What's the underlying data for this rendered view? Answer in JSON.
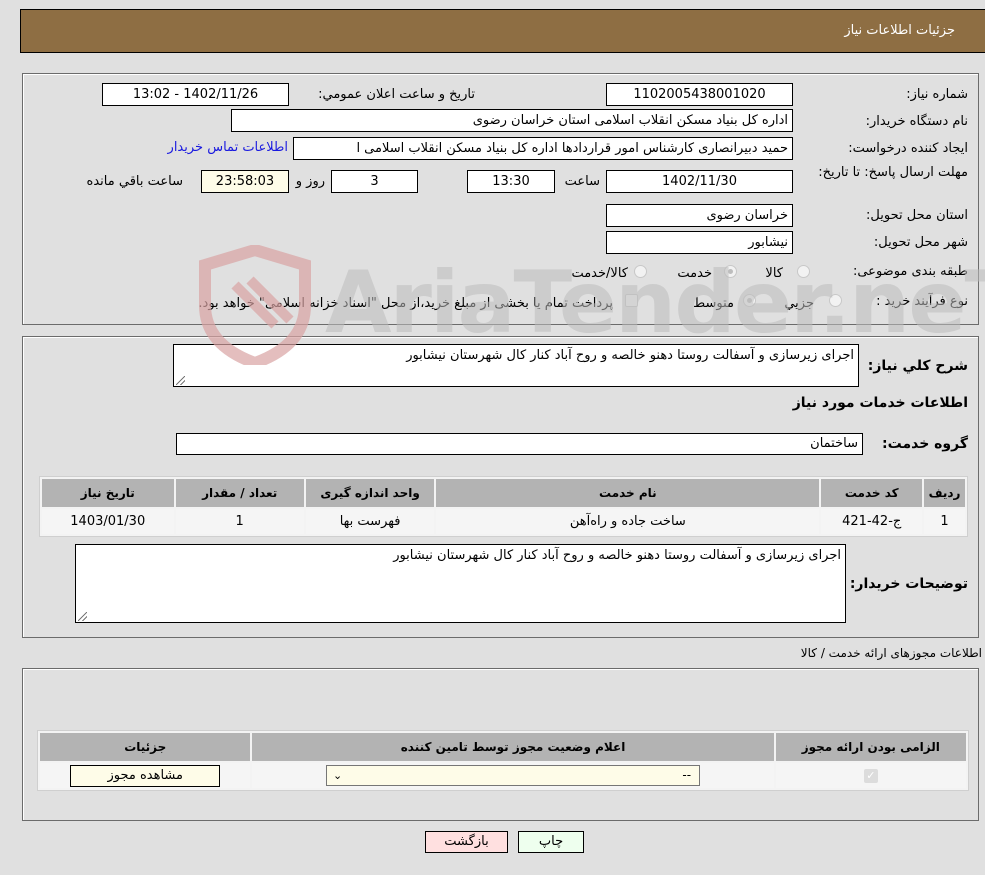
{
  "header": {
    "title": "جزئیات اطلاعات نیاز"
  },
  "details": {
    "need_number_label": "شماره نیاز:",
    "need_number": "1102005438001020",
    "announce_label": "تاریخ و ساعت اعلان عمومي:",
    "announce_value": "1402/11/26 - 13:02",
    "buyer_org_label": "نام دستگاه خریدار:",
    "buyer_org": "اداره کل بنیاد مسکن انقلاب اسلامی استان خراسان رضوی",
    "creator_label": "ایجاد کننده درخواست:",
    "creator": "حمید دبیرانصاری کارشناس امور قراردادها اداره کل بنیاد مسکن انقلاب اسلامی ا",
    "contact_link": "اطلاعات تماس خریدار",
    "deadline_label": "مهلت ارسال پاسخ: تا تاریخ:",
    "deadline_date": "1402/11/30",
    "time_label": "ساعت",
    "deadline_time": "13:30",
    "days_value": "3",
    "days_label": "روز و",
    "remaining_time": "23:58:03",
    "remaining_label": "ساعت باقي مانده",
    "province_label": "استان محل تحویل:",
    "province": "خراسان رضوی",
    "city_label": "شهر محل تحویل:",
    "city": "نیشابور",
    "category_label": "طبقه بندی موضوعی:",
    "category_options": [
      {
        "label": "کالا",
        "checked": false
      },
      {
        "label": "خدمت",
        "checked": true
      },
      {
        "label": "کالا/خدمت",
        "checked": false
      }
    ],
    "process_label": "نوع فرآیند خرید :",
    "process_options": [
      {
        "label": "جزيي",
        "checked": false
      },
      {
        "label": "متوسط",
        "checked": true
      }
    ],
    "treasury_note": "پرداخت تمام یا بخشی از مبلغ خرید،از محل \"اسناد خزانه اسلامی\" خواهد بود."
  },
  "services": {
    "general_desc_label": "شرح کلي نیاز:",
    "general_desc": "اجرای زیرسازی و آسفالت روستا دهنو خالصه و روح آباد کنار کال شهرستان نیشابور",
    "section_title": "اطلاعات خدمات مورد نیاز",
    "group_label": "گروه خدمت:",
    "group_value": "ساختمان",
    "table": {
      "headers": [
        "ردیف",
        "کد خدمت",
        "نام خدمت",
        "واحد اندازه گیری",
        "تعداد / مقدار",
        "تاریخ نیاز"
      ],
      "rows": [
        [
          "1",
          "ج-42-421",
          "ساخت جاده و راه‌آهن",
          "فهرست بها",
          "1",
          "1403/01/30"
        ]
      ]
    },
    "buyer_notes_label": "توضیحات خریدار:",
    "buyer_notes": "اجرای زیرسازی و آسفالت روستا دهنو خالصه و روح آباد کنار کال شهرستان نیشابور"
  },
  "permits": {
    "section_title": "اطلاعات مجوزهای ارائه خدمت / کالا",
    "headers": [
      "الزامی بودن ارائه مجوز",
      "اعلام وضعیت مجوز توسط تامین کننده",
      "جزئیات"
    ],
    "row": {
      "required_checked": true,
      "status_value": "--",
      "view_button": "مشاهده مجوز"
    }
  },
  "actions": {
    "print": "چاپ",
    "back": "بازگشت"
  },
  "watermark": {
    "text": "AriaTender.neT"
  }
}
